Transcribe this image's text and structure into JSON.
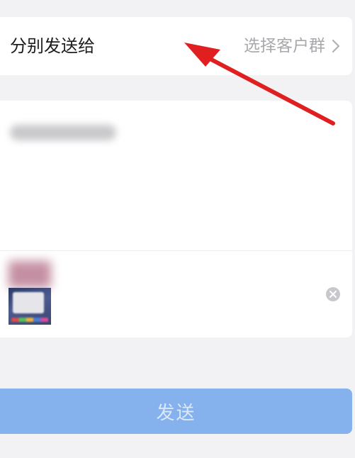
{
  "recipient": {
    "label": "分别发送给",
    "select_label": "选择客户群",
    "chevron_icon": "chevron-right-icon"
  },
  "attachment": {
    "remove_icon": "close-circle-icon"
  },
  "send_button": {
    "label": "发送"
  },
  "annotation": {
    "arrow_icon": "red-arrow-icon",
    "color": "#e02020"
  },
  "colors": {
    "background": "#f2f2f4",
    "card": "#ffffff",
    "send_button_disabled": "#85b1ec",
    "muted_text": "#a9a9ad"
  }
}
